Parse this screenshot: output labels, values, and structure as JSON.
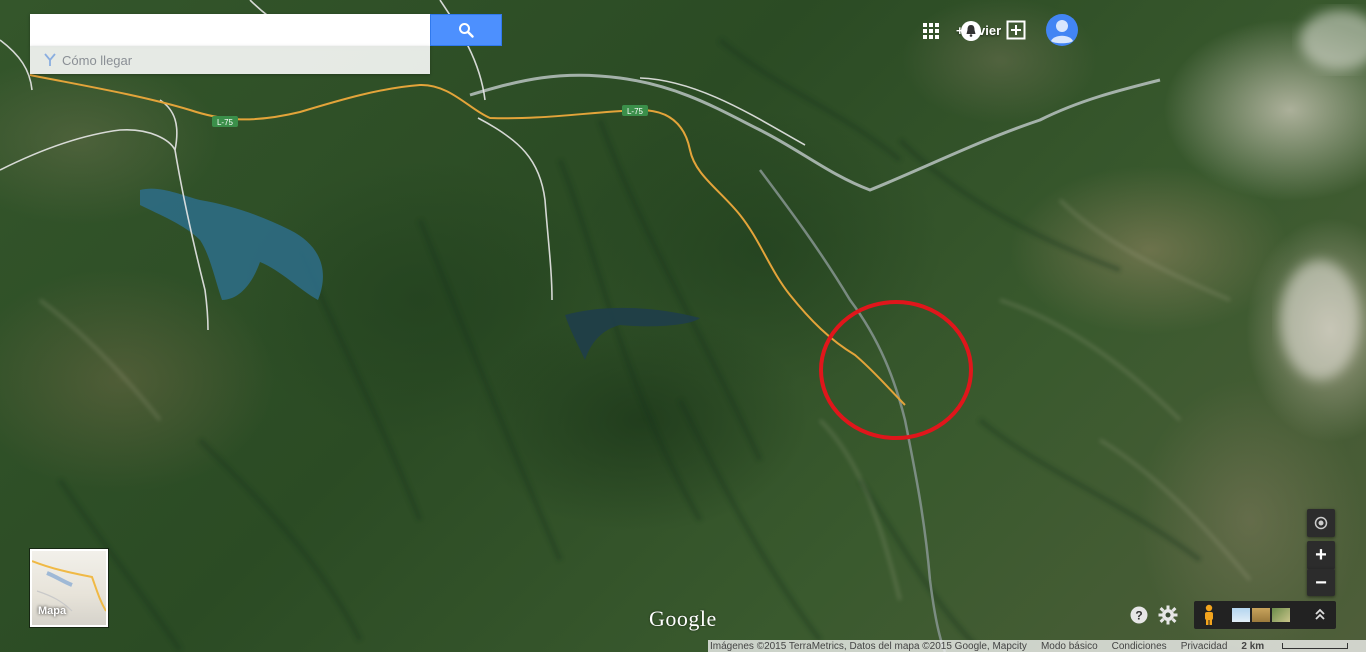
{
  "search": {
    "value": "",
    "placeholder": "",
    "directions_label": "Cómo llegar"
  },
  "header": {
    "user_label": "+Javier",
    "icons": [
      "apps-icon",
      "notifications-icon",
      "share-icon",
      "account-avatar-icon"
    ]
  },
  "map": {
    "road_labels": [
      "L-75",
      "L-75"
    ],
    "highlight_color": "#e0161b"
  },
  "maptype": {
    "label": "Mapa"
  },
  "branding": {
    "logo_text": "Google"
  },
  "footer": {
    "attribution": "Imágenes ©2015 TerraMetrics, Datos del mapa ©2015 Google, Mapcity",
    "links": [
      "Modo básico",
      "Condiciones",
      "Privacidad"
    ],
    "scale": "2 km"
  },
  "colors": {
    "search_button": "#4d90fe",
    "control_bg": "#2c2c2c"
  }
}
